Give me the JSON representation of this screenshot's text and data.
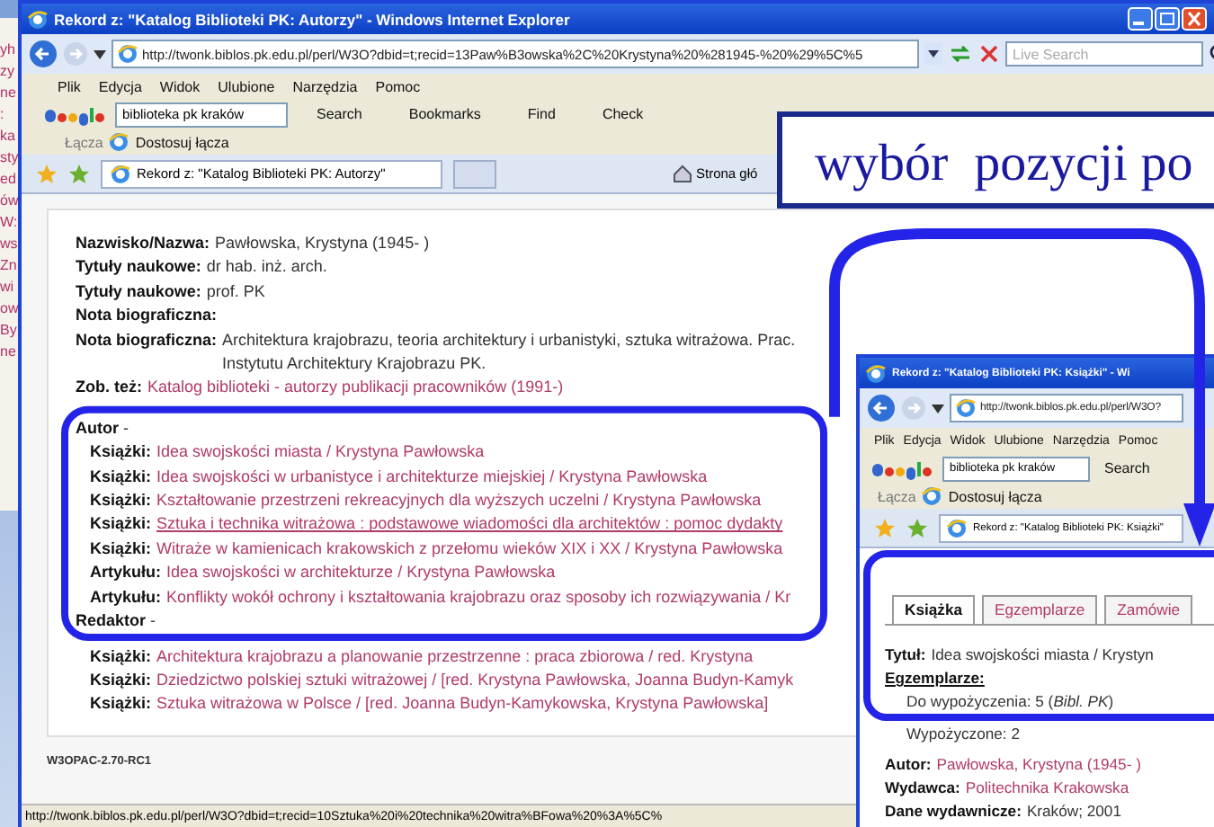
{
  "background_window": {
    "fragments": [
      "yh",
      "zy",
      "ne",
      ":",
      "ka",
      "sty",
      "ed",
      "ów",
      "W:",
      "ws",
      "Zn",
      "wi",
      "ow",
      "By",
      "ne"
    ]
  },
  "main_window": {
    "title": "Rekord z: \"Katalog Biblioteki PK: Autorzy\" - Windows Internet Explorer",
    "address": "http://twonk.biblos.pk.edu.pl/perl/W3O?dbid=t;recid=13Paw%B3owska%2C%20Krystyna%20%281945-%20%29%5C%5",
    "search_placeholder": "Live Search",
    "menu": [
      "Plik",
      "Edycja",
      "Widok",
      "Ulubione",
      "Narzędzia",
      "Pomoc"
    ],
    "google_toolbar": {
      "query": "biblioteka pk kraków",
      "items": [
        "Search",
        "Bookmarks",
        "Find",
        "Check"
      ]
    },
    "links": {
      "label": "Łącza",
      "item": "Dostosuj łącza"
    },
    "tabs": [
      {
        "label": "Rekord z: \"Katalog Biblioteki PK: Autorzy\"",
        "selected": true
      }
    ],
    "home_label": "Strona głó",
    "record": [
      {
        "kind": "field",
        "label": "Nazwisko/Nazwa:",
        "value": "Pawłowska, Krystyna (1945- )"
      },
      {
        "kind": "field",
        "label": "Tytuły naukowe:",
        "value": "dr hab. inż. arch."
      },
      {
        "kind": "field",
        "label": "Tytuły naukowe:",
        "value": "prof. PK"
      },
      {
        "kind": "field",
        "label": "Nota biograficzna:"
      },
      {
        "kind": "field",
        "label": "Nota biograficzna:",
        "value": "Architektura krajobrazu, teoria architektury i urbanistyki, sztuka witrażowa. Prac. Instytutu Architektury Krajobrazu PK."
      },
      {
        "kind": "link",
        "label": "Zob. też:",
        "value": "Katalog biblioteki - autorzy publikacji pracowników (1991-)",
        "underlined": false
      },
      {
        "kind": "heading",
        "text": "**Autor** -",
        "children": [
          {
            "kind": "link",
            "label": "Książki:",
            "value": "Idea swojskości miasta / Krystyna Pawłowska",
            "underlined": false
          },
          {
            "kind": "link",
            "label": "Książki:",
            "value": "Idea swojskości w urbanistyce i architekturze miejskiej / Krystyna Pawłowska",
            "underlined": false
          },
          {
            "kind": "link",
            "label": "Książki:",
            "value": "Kształtowanie przestrzeni rekreacyjnych dla wyższych uczelni / Krystyna Pawłowska",
            "underlined": false
          },
          {
            "kind": "link",
            "label": "Książki:",
            "value": "Sztuka i technika witrażowa : podstawowe wiadomości dla architektów : pomoc dydakty",
            "underlined": true
          },
          {
            "kind": "link",
            "label": "Książki:",
            "value": "Witraże w kamienicach krakowskich z przełomu wieków XIX i XX / Krystyna Pawłowska",
            "underlined": false
          },
          {
            "kind": "link",
            "label": "Artykułu:",
            "value": "Idea swojskości w architekturze / Krystyna Pawłowska",
            "underlined": false
          },
          {
            "kind": "link",
            "label": "Artykułu:",
            "value": "Konflikty wokół ochrony i kształtowania krajobrazu oraz sposoby ich rozwiązywania / Kr",
            "underlined": false
          }
        ]
      },
      {
        "kind": "heading",
        "text": "**Redaktor** -",
        "children": [
          {
            "kind": "link",
            "label": "Książki:",
            "value": "Architektura krajobrazu a planowanie przestrzenne : praca zbiorowa / red. Krystyna",
            "underlined": false
          },
          {
            "kind": "link",
            "label": "Książki:",
            "value": "Dziedzictwo polskiej sztuki witrażowej / [red. Krystyna Pawłowska, Joanna Budyn-Kamyk",
            "underlined": false
          },
          {
            "kind": "link",
            "label": "Książki:",
            "value": "Sztuka witrażowa w Polsce / [red. Joanna Budyn-Kamykowska, Krystyna Pawłowska]",
            "underlined": false
          }
        ]
      }
    ],
    "footer": "W3OPAC-2.70-RC1",
    "status_bar": "http://twonk.biblos.pk.edu.pl/perl/W3O?dbid=t;recid=10Sztuka%20i%20technika%20witra%BFowa%20%3A%5C%"
  },
  "callout": {
    "text": "wybór  pozycji po"
  },
  "detail_window": {
    "title": "Rekord z: \"Katalog Biblioteki PK: Książki\" - Wi",
    "address": "http://twonk.biblos.pk.edu.pl/perl/W3O?",
    "menu": [
      "Plik",
      "Edycja",
      "Widok",
      "Ulubione",
      "Narzędzia",
      "Pomoc"
    ],
    "google_toolbar": {
      "query": "biblioteka pk kraków",
      "items": [
        "Search"
      ]
    },
    "links": {
      "label": "Łącza",
      "item": "Dostosuj łącza"
    },
    "tabs": [
      {
        "label": "Rekord z: \"Katalog Biblioteki PK: Książki\"",
        "selected": true
      }
    ],
    "record_tabs": [
      {
        "label": "Książka",
        "selected": true
      },
      {
        "label": "Egzemplarze",
        "selected": false
      },
      {
        "label": "Zamówie",
        "selected": false
      }
    ],
    "title_line": {
      "label": "Tytuł:",
      "value": "Idea swojskości miasta / Krystyn"
    },
    "copies": {
      "label": "Egzemplarze:",
      "lines": [
        "Do wypożyczenia: 5  (*Bibl. PK*)",
        "Wypożyczone: 2"
      ]
    },
    "fields": [
      {
        "label": "Autor:",
        "value": "Pawłowska, Krystyna (1945- )",
        "link": true
      },
      {
        "label": "Wydawca:",
        "value": "Politechnika Krakowska",
        "link": true
      },
      {
        "label": "Dane wydawnicze:",
        "value": "Kraków; 2001",
        "link": false
      }
    ]
  }
}
